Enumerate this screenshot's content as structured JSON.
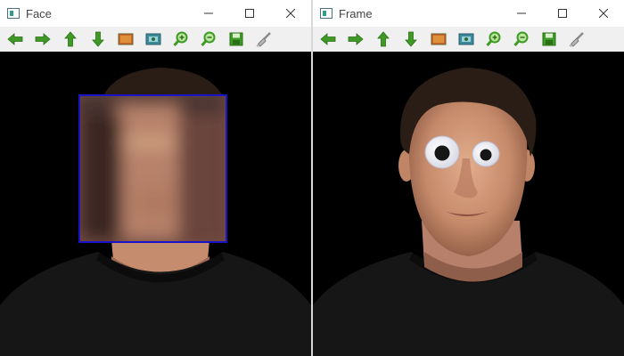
{
  "windows": [
    {
      "id": "left",
      "title": "Face"
    },
    {
      "id": "right",
      "title": "Frame"
    }
  ],
  "toolbar_icons": [
    "arrow-left-icon",
    "arrow-right-icon",
    "arrow-up-icon",
    "arrow-down-icon",
    "image-icon",
    "save-image-icon",
    "zoom-in-icon",
    "zoom-out-icon",
    "save-icon",
    "brush-icon"
  ],
  "window_controls": [
    "minimize-icon",
    "maximize-icon",
    "close-icon"
  ],
  "colors": {
    "blur_box_border": "#1a13c8",
    "toolbar_green": "#3f9a25",
    "background": "#000000"
  }
}
